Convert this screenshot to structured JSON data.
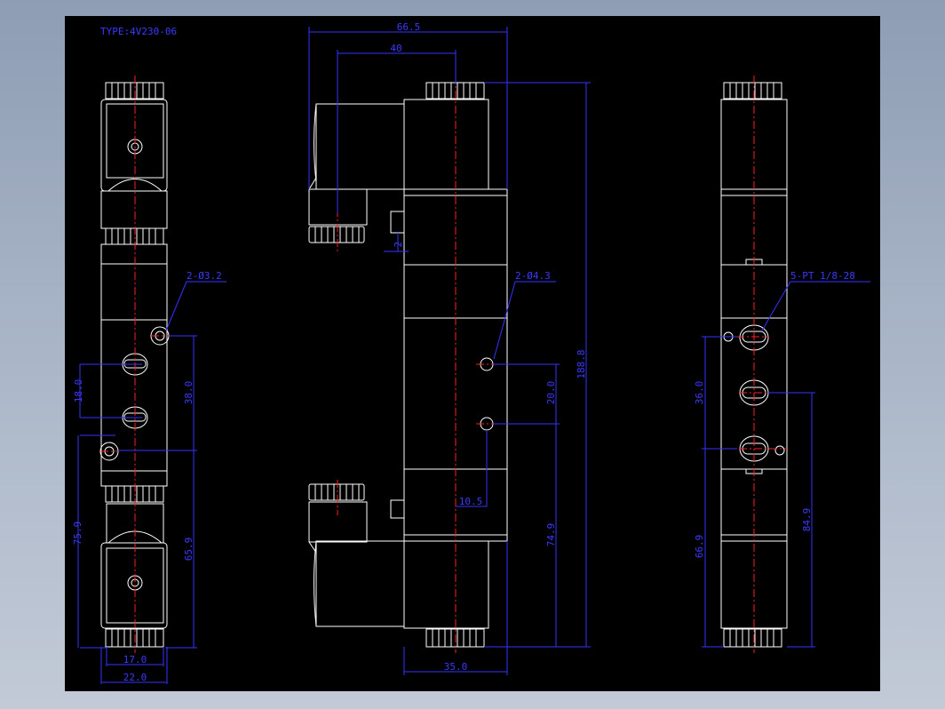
{
  "title": "TYPE:4V230-06",
  "colors": {
    "outline": "#ffffff",
    "dimension": "#3333ff",
    "centerline": "#ff2020",
    "background": "#000000"
  },
  "dims": {
    "width_66_5": "66.5",
    "width_40": "40",
    "overall_188_8": "188.8",
    "width_35_0": "35.0",
    "pitch_20_0": "20.0",
    "offset_10_5": "10.5",
    "height_74_9": "74.9",
    "width_17_0": "17.0",
    "width_22_0": "22.0",
    "pitch_18_0": "18.0",
    "pitch_38_0": "38.0",
    "height_75_9": "75.9",
    "height_65_9": "65.9",
    "pitch_36_0": "36.0",
    "height_84_9": "84.9",
    "height_66_9": "66.9",
    "small_2": "2"
  },
  "callouts": {
    "mount_holes_left": "2-Ø3.2",
    "mount_holes_mid": "2-Ø4.3",
    "ports_right": "5-PT 1/8-28"
  }
}
